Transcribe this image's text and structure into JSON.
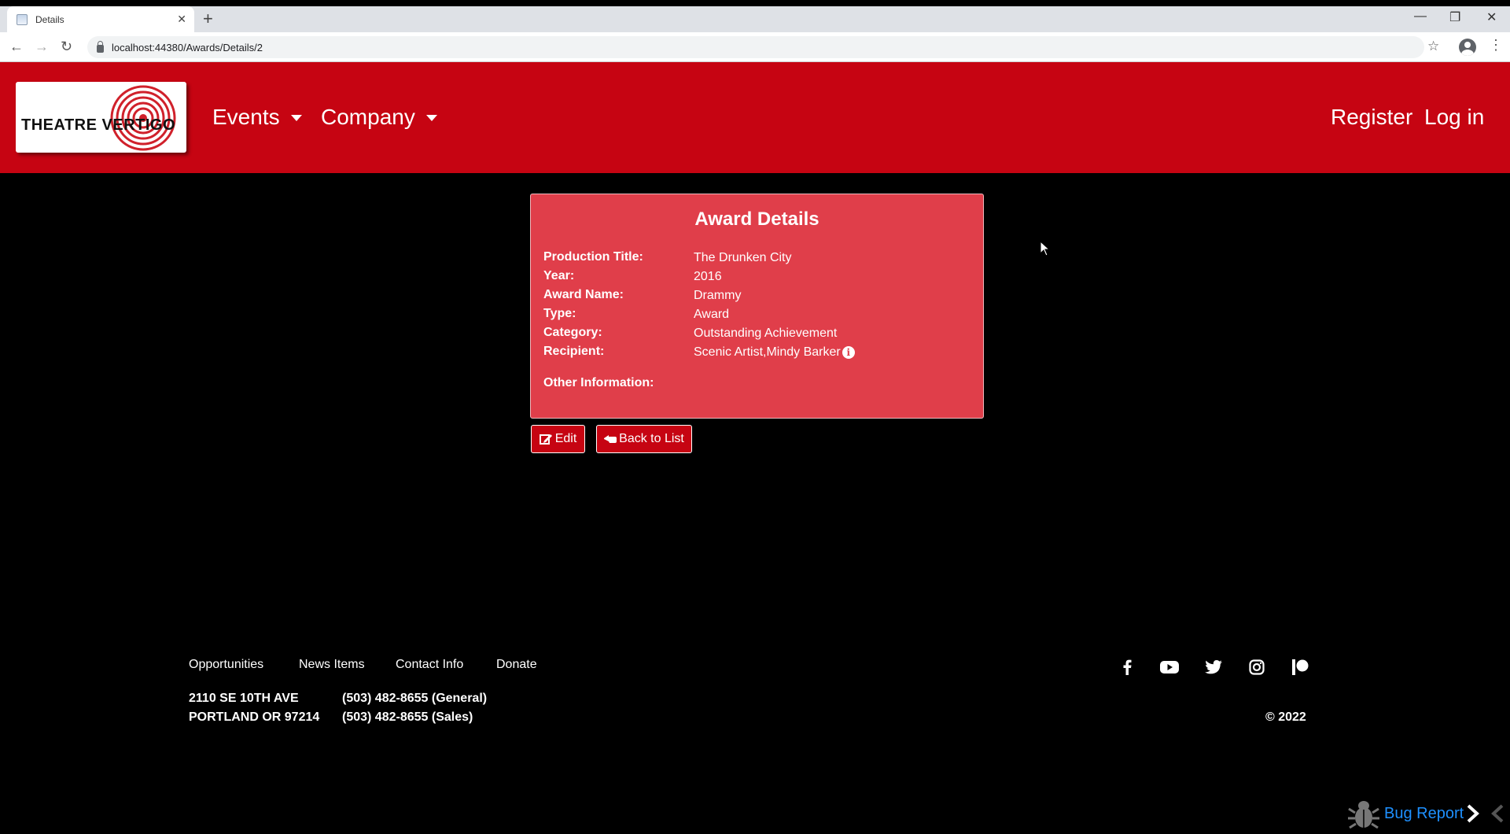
{
  "browser": {
    "tab_title": "Details",
    "url": "localhost:44380/Awards/Details/2"
  },
  "header": {
    "logo_text": "THEATRE VERTIGO",
    "nav": [
      {
        "label": "Events"
      },
      {
        "label": "Company"
      }
    ],
    "register_label": "Register",
    "login_label": "Log in",
    "brand_color": "#c60412"
  },
  "card": {
    "title": "Award Details",
    "fields": [
      {
        "label": "Production Title:",
        "value": "The Drunken City"
      },
      {
        "label": "Year:",
        "value": "2016"
      },
      {
        "label": "Award Name:",
        "value": "Drammy"
      },
      {
        "label": "Type:",
        "value": "Award"
      },
      {
        "label": "Category:",
        "value": "Outstanding Achievement"
      },
      {
        "label": "Recipient:",
        "value": "Scenic Artist,Mindy Barker"
      },
      {
        "label": "Other Information:",
        "value": ""
      }
    ],
    "card_color": "#e03e4a"
  },
  "actions": {
    "edit_label": "Edit",
    "back_label": "Back to List"
  },
  "footer": {
    "links": [
      {
        "label": "Opportunities"
      },
      {
        "label": "News Items"
      },
      {
        "label": "Contact Info"
      },
      {
        "label": "Donate"
      }
    ],
    "address_line1": "2110 SE 10TH AVE",
    "address_line2": "PORTLAND OR 97214",
    "phone_general": "(503) 482-8655 (General)",
    "phone_sales": "(503) 482-8655 (Sales)",
    "social_icons": [
      "facebook-icon",
      "youtube-icon",
      "twitter-icon",
      "instagram-icon",
      "patreon-icon"
    ],
    "copyright": "© 2022"
  },
  "bug_report": {
    "label": "Bug Report",
    "color": "#1e90ff"
  }
}
